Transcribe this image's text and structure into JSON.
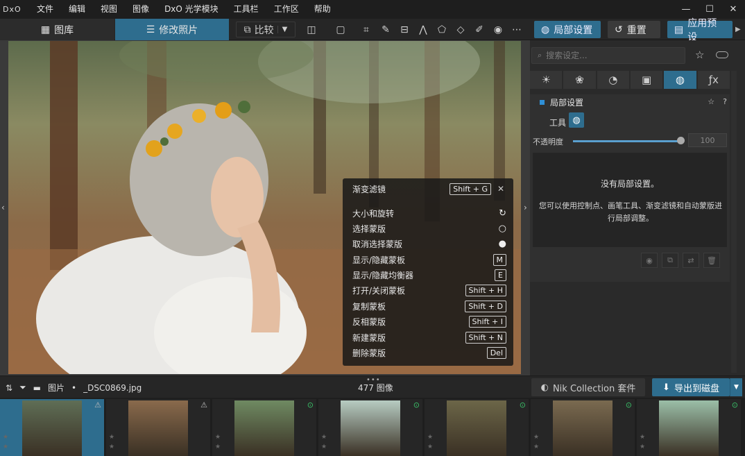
{
  "app": {
    "logo": "DxO"
  },
  "menu": [
    "文件",
    "编辑",
    "视图",
    "图像",
    "DxO 光学模块",
    "工具栏",
    "工作区",
    "帮助"
  ],
  "window_controls": [
    "—",
    "☐",
    "✕"
  ],
  "toolbar": {
    "library_tab": "图库",
    "edit_tab": "修改照片",
    "compare": "比较",
    "local_adjust": "局部设置",
    "reset": "重置",
    "apply_preset": "应用预设"
  },
  "popup": {
    "items": [
      {
        "label": "渐变滤镜",
        "shortcut": "Shift + G"
      },
      {
        "label": "大小和旋转",
        "shortcut": ""
      },
      {
        "label": "选择蒙版",
        "shortcut": ""
      },
      {
        "label": "取消选择蒙版",
        "shortcut": ""
      },
      {
        "label": "显示/隐藏蒙板",
        "shortcut": "M"
      },
      {
        "label": "显示/隐藏均衡器",
        "shortcut": "E"
      },
      {
        "label": "打开/关闭蒙板",
        "shortcut": "Shift + H"
      },
      {
        "label": "复制蒙板",
        "shortcut": "Shift + D"
      },
      {
        "label": "反相蒙版",
        "shortcut": "Shift + I"
      },
      {
        "label": "新建蒙版",
        "shortcut": "Shift + N"
      },
      {
        "label": "删除蒙版",
        "shortcut": "Del"
      }
    ]
  },
  "panel": {
    "search_placeholder": "搜索设定...",
    "section_title": "局部设置",
    "tool_label": "工具",
    "opacity_label": "不透明度",
    "opacity_value": "100",
    "empty_title": "没有局部设置。",
    "empty_desc": "您可以使用控制点、画笔工具、渐变滤镜和自动蒙版进行局部调整。"
  },
  "filmstrip_bar": {
    "folder": "图片",
    "separator": "•",
    "filename": "_DSC0869.jpg",
    "count": "477 图像",
    "nik": "Nik Collection 套件",
    "export": "导出到磁盘"
  },
  "thumbnails": [
    {
      "selected": true,
      "color": "#5f6e56"
    },
    {
      "selected": false,
      "color": "#8a6a4c"
    },
    {
      "selected": false,
      "color": "#6f8a62"
    },
    {
      "selected": false,
      "color": "#b7ccc2"
    },
    {
      "selected": false,
      "color": "#6c6648"
    },
    {
      "selected": false,
      "color": "#7a6a50"
    },
    {
      "selected": false,
      "color": "#9bbfa8"
    }
  ],
  "colors": {
    "accent": "#2e6d8e",
    "section_dot": "#2f8fd6",
    "flag_green": "#3ac46a"
  }
}
